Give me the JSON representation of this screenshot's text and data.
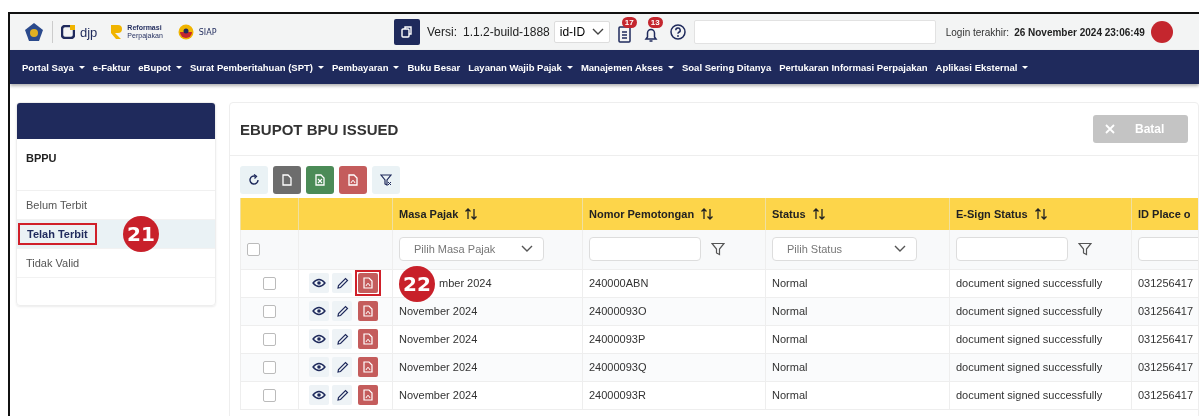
{
  "header": {
    "logo_djp": "djp",
    "logo_reform_top": "Reformasi",
    "logo_reform_bottom": "Perpajakan",
    "logo_siap": "SIAP",
    "version_label": "Versi:",
    "version": "1.1.2-build-1888",
    "locale": "id-ID",
    "doc_badge": "17",
    "bell_badge": "13",
    "login_label": "Login terakhir:",
    "login_time": "26 November 2024 23:06:49"
  },
  "nav": [
    {
      "label": "Portal Saya",
      "dropdown": true
    },
    {
      "label": "e-Faktur",
      "dropdown": false
    },
    {
      "label": "eBupot",
      "dropdown": true
    },
    {
      "label": "Surat Pemberitahuan (SPT)",
      "dropdown": true
    },
    {
      "label": "Pembayaran",
      "dropdown": true
    },
    {
      "label": "Buku Besar",
      "dropdown": false
    },
    {
      "label": "Layanan Wajib Pajak",
      "dropdown": true
    },
    {
      "label": "Manajemen Akses",
      "dropdown": true
    },
    {
      "label": "Soal Sering Ditanya",
      "dropdown": false
    },
    {
      "label": "Pertukaran Informasi Perpajakan",
      "dropdown": false
    },
    {
      "label": "Aplikasi Eksternal",
      "dropdown": true
    }
  ],
  "sidebar": {
    "title": "BPPU",
    "items": [
      {
        "label": "Belum Terbit",
        "selected": false
      },
      {
        "label": "Telah Terbit",
        "selected": true,
        "annotation": "21"
      },
      {
        "label": "Tidak Valid",
        "selected": false
      }
    ]
  },
  "page": {
    "title": "EBUPOT BPU ISSUED",
    "cancel_button": {
      "label": "Batal",
      "disabled": true
    }
  },
  "table": {
    "select_all_checked": false,
    "columns": [
      {
        "label": "Masa Pajak",
        "kind": "select",
        "placeholder": "Pilih Masa Pajak"
      },
      {
        "label": "Nomor Pemotongan",
        "kind": "text"
      },
      {
        "label": "Status",
        "kind": "select",
        "placeholder": "Pilih Status"
      },
      {
        "label": "E-Sign Status",
        "kind": "text"
      },
      {
        "label": "ID Place o",
        "kind": "input"
      }
    ],
    "rows": [
      {
        "checked": false,
        "annotation": "22",
        "cells": [
          "mber 2024",
          "240000ABN",
          "Normal",
          "document signed successfully",
          "031256417"
        ]
      },
      {
        "checked": false,
        "cells": [
          "November 2024",
          "24000093O",
          "Normal",
          "document signed successfully",
          "031256417"
        ]
      },
      {
        "checked": false,
        "cells": [
          "November 2024",
          "24000093P",
          "Normal",
          "document signed successfully",
          "031256417"
        ]
      },
      {
        "checked": false,
        "cells": [
          "November 2024",
          "24000093Q",
          "Normal",
          "document signed successfully",
          "031256417"
        ]
      },
      {
        "checked": false,
        "cells": [
          "November 2024",
          "24000093R",
          "Normal",
          "document signed successfully",
          "031256417"
        ]
      }
    ]
  }
}
